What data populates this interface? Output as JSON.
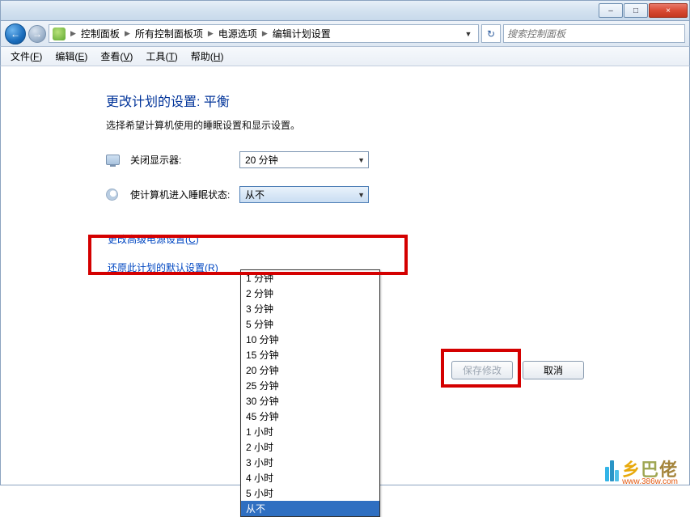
{
  "window_controls": {
    "minimize": "–",
    "maximize": "□",
    "close": "×"
  },
  "nav": {
    "back_icon": "←",
    "forward_icon": "→",
    "refresh_icon": "↻"
  },
  "breadcrumb": {
    "seg1": "控制面板",
    "seg2": "所有控制面板项",
    "seg3": "电源选项",
    "seg4": "编辑计划设置",
    "sep": "▶",
    "dropdown_arrow": "▼"
  },
  "search": {
    "placeholder": "搜索控制面板"
  },
  "menu": {
    "file": "文件",
    "file_u": "F",
    "edit": "编辑",
    "edit_u": "E",
    "view": "查看",
    "view_u": "V",
    "tools": "工具",
    "tools_u": "T",
    "help": "帮助",
    "help_u": "H"
  },
  "page": {
    "title": "更改计划的设置: 平衡",
    "desc": "选择希望计算机使用的睡眠设置和显示设置。",
    "display_label": "关闭显示器:",
    "sleep_label": "使计算机进入睡眠状态:",
    "display_value": "20 分钟",
    "sleep_value": "从不",
    "combo_arrow": "▼"
  },
  "links": {
    "adv": "更改高级电源设置",
    "adv_u": "C",
    "reset": "还原此计划的默认设置",
    "reset_u": "R"
  },
  "dropdown": {
    "opt0": "1 分钟",
    "opt1": "2 分钟",
    "opt2": "3 分钟",
    "opt3": "5 分钟",
    "opt4": "10 分钟",
    "opt5": "15 分钟",
    "opt6": "20 分钟",
    "opt7": "25 分钟",
    "opt8": "30 分钟",
    "opt9": "45 分钟",
    "opt10": "1 小时",
    "opt11": "2 小时",
    "opt12": "3 小时",
    "opt13": "4 小时",
    "opt14": "5 小时",
    "opt15": "从不"
  },
  "buttons": {
    "save": "保存修改",
    "cancel": "取消"
  },
  "watermark": {
    "char1": "乡",
    "char2": "巴",
    "char3": "佬",
    "url": "www.386w.com"
  }
}
